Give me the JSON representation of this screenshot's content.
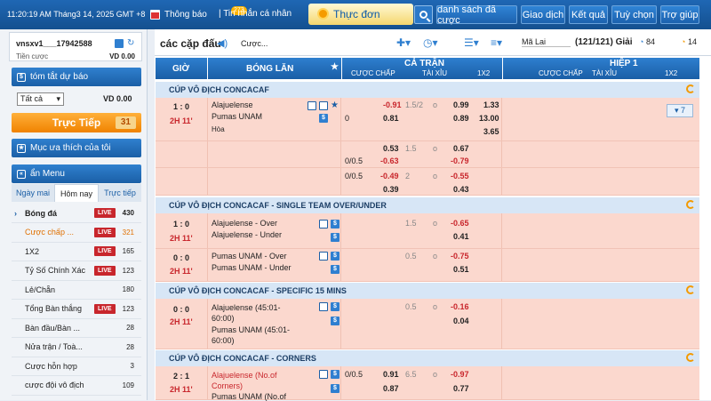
{
  "topbar": {
    "clock": "11:20:19 AM Tháng3 14, 2025 GMT +8",
    "notif": "Thông báo",
    "notif_count": "273",
    "messages": "| Tin nhắn cá nhân",
    "menu": "Thực đơn",
    "buttons": [
      "danh sách đã cược",
      "Giao dịch",
      "Kết quả",
      "Tuỳ chọn",
      "Trợ giúp"
    ]
  },
  "account": {
    "name": "vnsxv1___17942588",
    "cash_label": "Tiền cược",
    "cash_value": "VD 0.00"
  },
  "summary": {
    "title": "tóm tắt dự báo",
    "select": "Tất cả",
    "value": "VD 0.00"
  },
  "live": {
    "label": "Trực Tiếp",
    "count": "31"
  },
  "favorites": {
    "label": "Mục ưa thích của tôi"
  },
  "menu": {
    "title": "ẩn Menu",
    "tabs": [
      "Ngày mai",
      "Hôm nay",
      "Trực tiếp"
    ]
  },
  "sports": [
    {
      "label": "Bóng đá",
      "live": "LIVE",
      "count": "430"
    },
    {
      "label": "Cược chấp ...",
      "live": "LIVE",
      "count": "321"
    },
    {
      "label": "1X2",
      "live": "LIVE",
      "count": "165"
    },
    {
      "label": "Tỷ Số Chính Xác",
      "live": "LIVE",
      "count": "123"
    },
    {
      "label": "Lẻ/Chẵn",
      "live": "",
      "count": "180"
    },
    {
      "label": "Tổng Bàn thắng",
      "live": "LIVE",
      "count": "123"
    },
    {
      "label": "Bàn đầu/Bàn ...",
      "live": "",
      "count": "28"
    },
    {
      "label": "Nửa trận / Toà...",
      "live": "",
      "count": "28"
    },
    {
      "label": "Cược hỗn hợp",
      "live": "",
      "count": "3"
    },
    {
      "label": "cược đội vô địch",
      "live": "",
      "count": "109"
    }
  ],
  "main": {
    "title": "các cặp đấu",
    "search": "Cược...",
    "odds_type": "Mã Lai",
    "count": "(121/121) Giải",
    "stat1": "84",
    "stat2": "14"
  },
  "header": {
    "time": "GIỜ",
    "live_ball": "BÓNG LĂN",
    "full": "CẢ TRẬN",
    "half": "HIỆP 1",
    "handicap": "CƯỢC CHẤP",
    "ou": "TÀI XỈU",
    "x12": "1X2",
    "handicap2": "CƯỢC CHẤP",
    "ou2": "TÀI XỈU",
    "x122": "1X2"
  },
  "leagues": [
    "CÚP VÔ ĐỊCH CONCACAF",
    "CÚP VÔ ĐỊCH CONCACAF - SINGLE TEAM OVER/UNDER",
    "CÚP VÔ ĐỊCH CONCACAF - SPECIFIC 15 MINS",
    "CÚP VÔ ĐỊCH CONCACAF - CORNERS"
  ],
  "m1": {
    "score": "1 : 0",
    "time": "2H 11'",
    "home": "Alajuelense",
    "away": "Pumas UNAM",
    "draw": "Hòa",
    "more": "7",
    "r1": {
      "hcp": "",
      "ho": "-0.91",
      "ou": "1.5/2",
      "o": "o",
      "oo": "0.99",
      "x": "1.33"
    },
    "r2": {
      "hcp": "0",
      "ho": "0.81",
      "oo": "0.89",
      "x": "13.00"
    },
    "r3": {
      "x": "3.65"
    },
    "r4": {
      "ho": "0.53",
      "ou": "1.5",
      "o": "o",
      "oo": "0.67"
    },
    "r5": {
      "hcp": "0/0.5",
      "ho": "-0.63",
      "oo": "-0.79"
    },
    "r6": {
      "hcp": "0/0.5",
      "ho": "-0.49",
      "ou": "2",
      "o": "o",
      "oo": "-0.55"
    },
    "r7": {
      "ho": "0.39",
      "oo": "0.43"
    }
  },
  "m2": {
    "score": "1 : 0",
    "time": "2H 11'",
    "home": "Alajuelense - Over",
    "away": "Alajuelense - Under",
    "ou": "1.5",
    "o": "o",
    "v1": "-0.65",
    "v2": "0.41"
  },
  "m3": {
    "score": "0 : 0",
    "time": "2H 11'",
    "home": "Pumas UNAM - Over",
    "away": "Pumas UNAM - Under",
    "ou": "0.5",
    "o": "o",
    "v1": "-0.75",
    "v2": "0.51"
  },
  "m4": {
    "score": "0 : 0",
    "time": "2H 11'",
    "home": "Alajuelense (45:01-60:00)",
    "away": "Pumas UNAM (45:01-60:00)",
    "ou": "0.5",
    "o": "o",
    "v1": "-0.16",
    "v2": "0.04"
  },
  "m5": {
    "score": "2 : 1",
    "time": "2H 11'",
    "home": "Alajuelense (No.of Corners)",
    "away": "Pumas UNAM (No.of",
    "hcp": "0/0.5",
    "ho1": "0.91",
    "ou": "6.5",
    "o": "o",
    "oo1": "-0.97",
    "ho2": "0.87",
    "oo2": "0.77"
  }
}
